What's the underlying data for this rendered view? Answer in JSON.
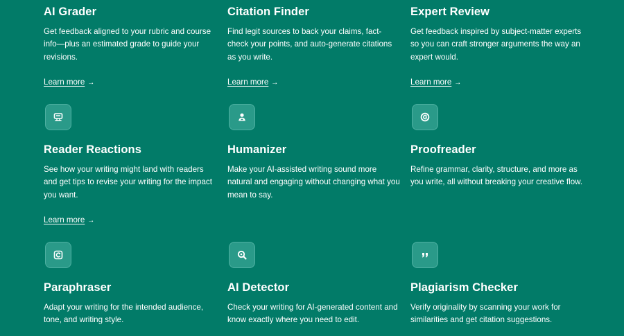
{
  "colors": {
    "background": "#027b68",
    "icon_tile": "#2a9a89",
    "text": "#ffffff"
  },
  "cards": [
    {
      "title": "AI Grader",
      "description": "Get feedback aligned to your rubric and course info—plus an estimated grade to guide your revisions.",
      "link": "Learn more",
      "icon": null
    },
    {
      "title": "Citation Finder",
      "description": "Find legit sources to back your claims, fact-check your points, and auto-generate citations as you write.",
      "link": "Learn more",
      "icon": null
    },
    {
      "title": "Expert Review",
      "description": "Get feedback inspired by subject-matter experts so you can craft stronger arguments the way an expert would.",
      "link": "Learn more",
      "icon": null
    },
    {
      "title": "Reader Reactions",
      "description": "See how your writing might land with readers and get tips to revise your writing for the impact you want.",
      "link": "Learn more",
      "icon": "reader-reactions-icon"
    },
    {
      "title": "Humanizer",
      "description": "Make your AI-assisted writing sound more natural and engaging without changing what you mean to say.",
      "link": "",
      "icon": "person-icon"
    },
    {
      "title": "Proofreader",
      "description": "Refine grammar, clarity, structure, and more as you write, all without breaking your creative flow.",
      "link": "",
      "icon": "proofread-icon"
    },
    {
      "title": "Paraphraser",
      "description": "Adapt your writing for the intended audience, tone, and writing style.",
      "link": "",
      "icon": "paraphrase-icon"
    },
    {
      "title": "AI Detector",
      "description": "Check your writing for AI-generated content and know exactly where you need to edit.",
      "link": "",
      "icon": "magnifier-icon"
    },
    {
      "title": "Plagiarism Checker",
      "description": "Verify originality by scanning your work for similarities and get citation suggestions.",
      "link": "",
      "icon": "quote-icon"
    }
  ]
}
